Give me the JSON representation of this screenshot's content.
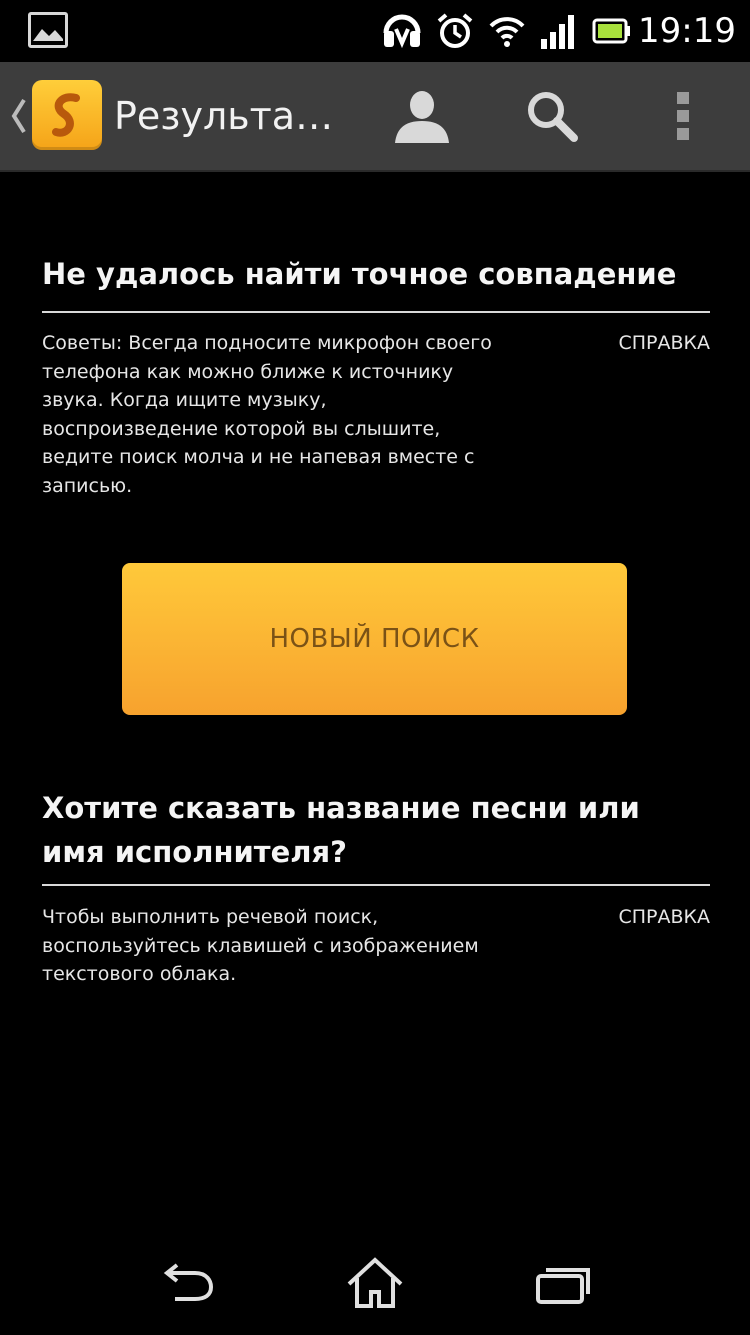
{
  "status_bar": {
    "time": "19:19",
    "icons": [
      "gallery-notification-icon",
      "headset-icon",
      "alarm-icon",
      "wifi-icon",
      "signal-icon",
      "battery-icon"
    ]
  },
  "action_bar": {
    "title": "Результа…",
    "app_icon": "shazam-s-icon",
    "buttons": [
      "profile-icon",
      "search-icon",
      "overflow-menu-icon"
    ]
  },
  "no_match": {
    "title": "Не удалось найти точное совпадение",
    "tip_lines": [
      "Советы: Всегда подносите микрофон своего",
      "телефона как можно ближе к источнику",
      "звука. Когда ищите музыку,",
      "воспроизведение которой вы слышите,",
      "ведите поиск молча и не напевая вместе с",
      "записью."
    ],
    "help_label": "СПРАВКА"
  },
  "new_search_button": {
    "label": "НОВЫЙ ПОИСК"
  },
  "voice_search": {
    "title_lines": [
      "Хотите сказать название песни или",
      "имя исполнителя?"
    ],
    "tip_lines": [
      "Чтобы выполнить речевой поиск,",
      "воспользуйтесь клавишей с изображением",
      "текстового облака."
    ],
    "help_label": "СПРАВКА"
  },
  "nav_bar": {
    "buttons": [
      "back-icon",
      "home-icon",
      "recent-apps-icon"
    ]
  },
  "colors": {
    "background": "#000000",
    "action_bar": "#3d3d3d",
    "accent": "#ffc93a",
    "accent_bottom": "#f7a22e",
    "button_text": "#7a5216"
  }
}
